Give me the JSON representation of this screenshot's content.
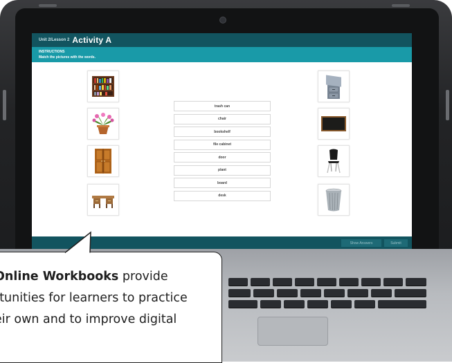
{
  "header": {
    "unit_label": "Unit 2/Lesson 2",
    "activity_title": "Activity A"
  },
  "instructions": {
    "heading": "INSTRUCTIONS",
    "text": "Match the pictures with the words."
  },
  "left_pictures": [
    "bookshelf-image",
    "plant-image",
    "door-image",
    "desk-image"
  ],
  "right_pictures": [
    "file-cabinet-image",
    "board-image",
    "chair-image",
    "trash-can-image"
  ],
  "words": [
    "trash can",
    "chair",
    "bookshelf",
    "file cabinet",
    "door",
    "plant",
    "board",
    "desk"
  ],
  "footer": {
    "show_answers": "Show Answers",
    "submit": "Submit"
  },
  "callout": {
    "bold_text": "Online Workbooks",
    "line1_rest": " provide",
    "line2": "rtunities for learners to practice",
    "line3": "eir own and to improve digital"
  },
  "colors": {
    "header": "#12545f",
    "instructions_bar": "#199aa8"
  }
}
